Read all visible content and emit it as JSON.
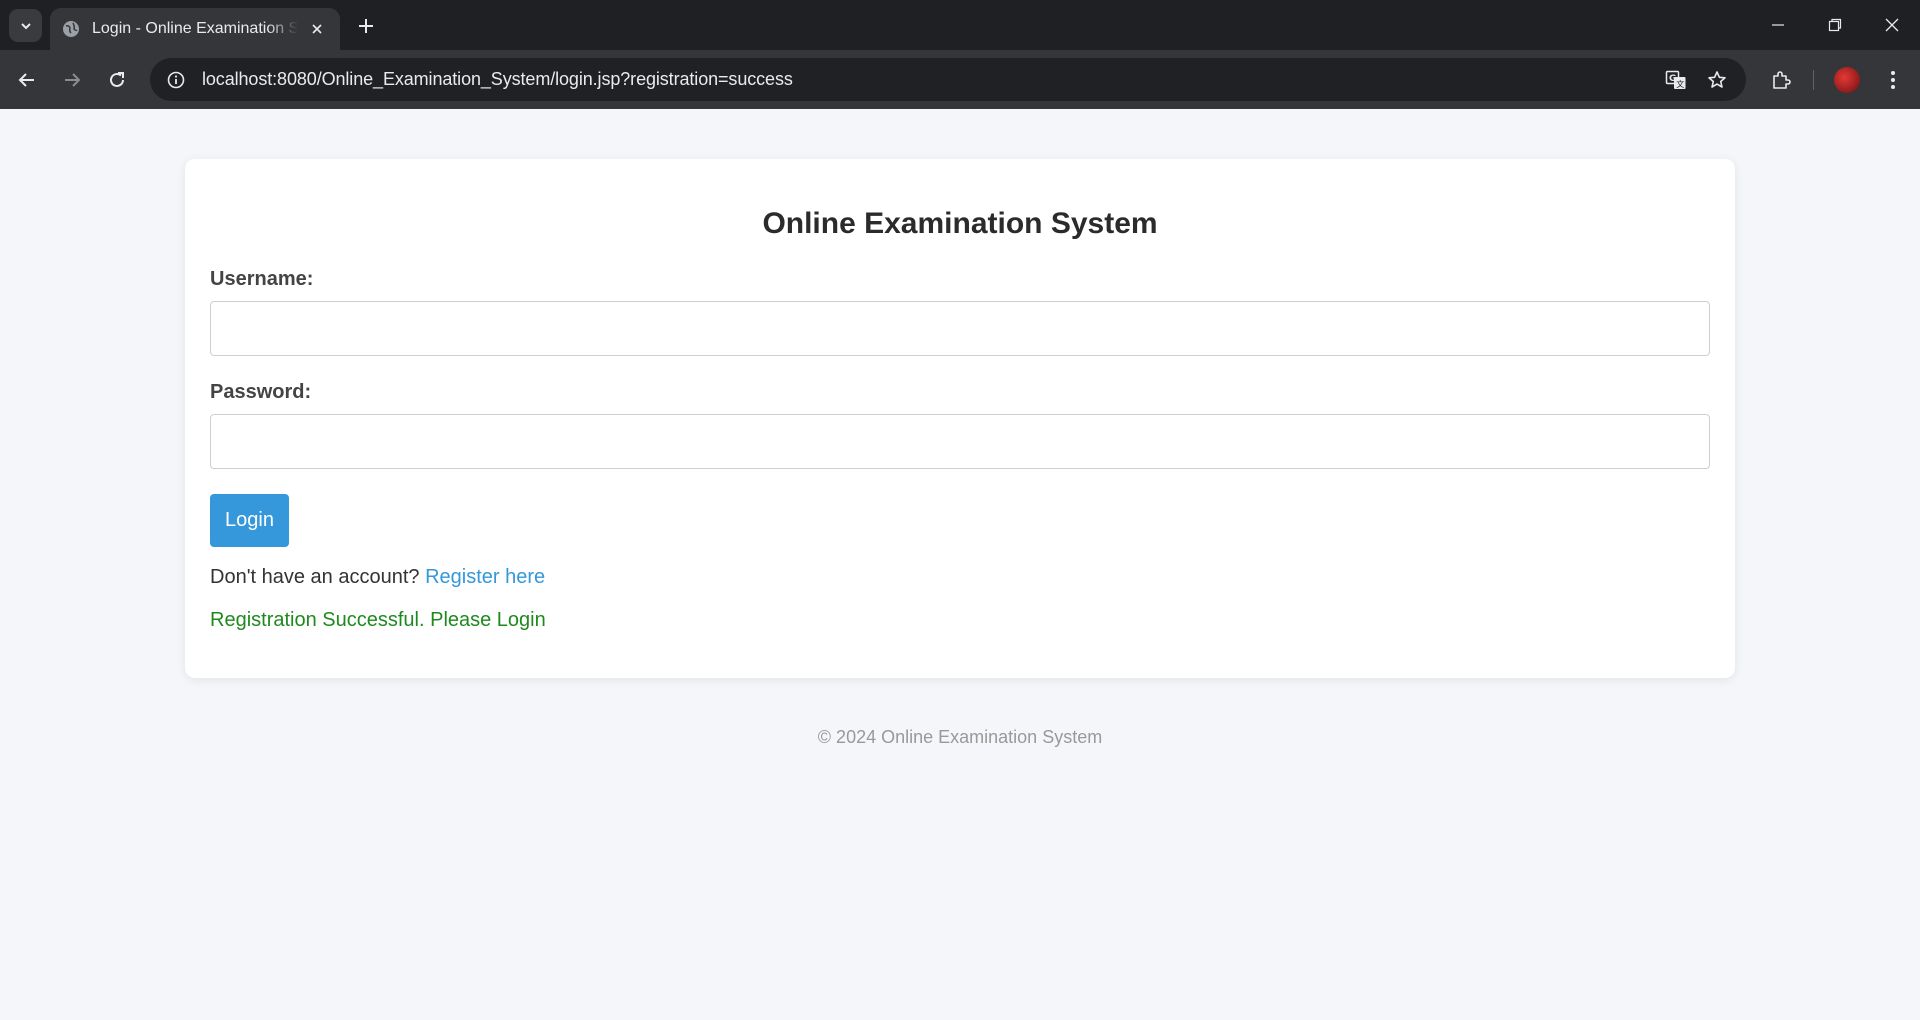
{
  "browser": {
    "tab_title": "Login - Online Examination System",
    "url_host": "localhost",
    "url_rest": ":8080/Online_Examination_System/login.jsp?registration=success"
  },
  "page": {
    "title": "Online Examination System",
    "username_label": "Username:",
    "username_value": "",
    "password_label": "Password:",
    "password_value": "",
    "login_button": "Login",
    "no_account_text": "Don't have an account? ",
    "register_link": "Register here",
    "success_message": "Registration Successful. Please Login",
    "footer": "© 2024 Online Examination System"
  },
  "colors": {
    "accent": "#3498db",
    "success": "#1e8a1e",
    "background": "#f4f6f9"
  },
  "icons": [
    "tab-search-icon",
    "globe-icon",
    "close-icon",
    "plus-icon",
    "minimize-icon",
    "restore-icon",
    "back-icon",
    "forward-icon",
    "reload-icon",
    "info-icon",
    "translate-icon",
    "star-icon",
    "extensions-icon",
    "menu-icon"
  ]
}
